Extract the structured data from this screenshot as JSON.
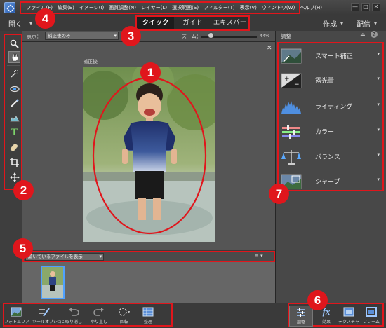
{
  "menu": {
    "items": [
      "ファイル(F)",
      "編集(E)",
      "イメージ(I)",
      "画質調整(N)",
      "レイヤー(L)",
      "選択範囲(S)",
      "フィルター(T)",
      "表示(V)",
      "ウィンドウ(W)",
      "ヘルプ(H)"
    ]
  },
  "toolbar": {
    "open_label": "開く",
    "mode_tabs": [
      "クイック",
      "ガイド",
      "エキスパート"
    ],
    "active_mode": "クイック",
    "create_label": "作成",
    "share_label": "配信"
  },
  "viewbar": {
    "view_label": "表示：",
    "view_value": "補正後のみ",
    "zoom_label": "ズーム：",
    "zoom_value": "44%",
    "zoom_level": 0.18
  },
  "canvas": {
    "image_label": "補正後"
  },
  "photo_bin": {
    "select_value": "開いているファイルを表示",
    "menu_glyph": "≡"
  },
  "adjust_panel": {
    "title": "調整",
    "items": [
      {
        "label": "スマート補正",
        "icon": "smart-fix-icon"
      },
      {
        "label": "露光量",
        "icon": "exposure-icon"
      },
      {
        "label": "ライティング",
        "icon": "lighting-icon"
      },
      {
        "label": "カラー",
        "icon": "color-icon"
      },
      {
        "label": "バランス",
        "icon": "balance-icon"
      },
      {
        "label": "シャープ",
        "icon": "sharpen-icon"
      }
    ]
  },
  "bottom_bar": {
    "photo_bin": "フォトエリア",
    "tool_options": "ツールオプション",
    "undo": "取り消し",
    "redo": "やり直し",
    "rotate": "回転",
    "organizer": "整理",
    "adjustments": "調整",
    "effects": "効果",
    "textures": "テクスチャ",
    "frames": "フレーム"
  },
  "callouts": [
    "1",
    "2",
    "3",
    "4",
    "5",
    "6",
    "7"
  ],
  "colors": {
    "callout": "#e0161c",
    "highlight": "#4fa1ff"
  }
}
